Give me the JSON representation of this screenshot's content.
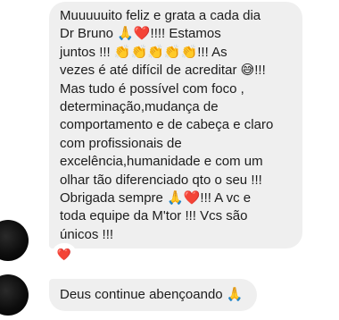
{
  "conversation": {
    "messages": [
      {
        "text": "Muuuuuito feliz e grata a cada dia\nDr Bruno 🙏❤️!!!! Estamos\njuntos !!! 👏👏👏👏👏!!! As\nvezes é até difícil de acreditar 😅!!!\nMas tudo é possível com foco ,\ndeterminação,mudança de\ncomportamento e de cabeça e claro\ncom profissionais de\nexcelência,humanidade e com um\nolhar tão diferenciado qto o seu !!!\nObrigada sempre 🙏❤️!!! A vc e\ntoda equipe da M'tor !!! Vcs são\núnicos !!!",
        "reaction": "❤️"
      },
      {
        "text": "Deus continue abençoando 🙏"
      }
    ]
  },
  "colors": {
    "bubble_background": "#efefef",
    "text": "#1c1c1c",
    "reaction_heart": "#e0245e"
  }
}
